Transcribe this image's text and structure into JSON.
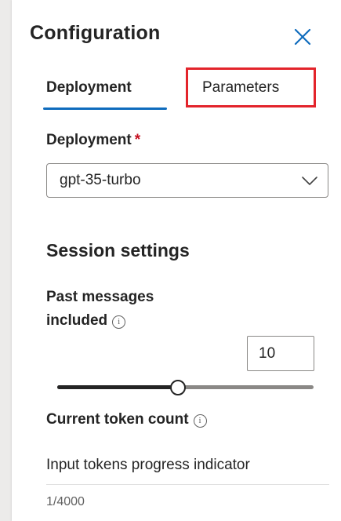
{
  "panel": {
    "title": "Configuration",
    "close_icon": "close-icon"
  },
  "tabs": [
    {
      "label": "Deployment",
      "selected": true
    },
    {
      "label": "Parameters",
      "selected": false,
      "highlighted": true
    }
  ],
  "deployment": {
    "label": "Deployment",
    "required_mark": "*",
    "selected_value": "gpt-35-turbo",
    "chevron_icon": "chevron-down-icon"
  },
  "session": {
    "heading": "Session settings",
    "past_messages_label": "Past messages included",
    "info_icon": "info-icon",
    "past_messages_value": "10",
    "slider_fraction": 0.47
  },
  "token": {
    "label": "Current token count",
    "info_icon": "info-icon",
    "progress_label": "Input tokens progress indicator",
    "count": "1/4000"
  },
  "colors": {
    "accent": "#0f6cbd",
    "highlight_border": "#e3242b",
    "required": "#c50f1f"
  }
}
